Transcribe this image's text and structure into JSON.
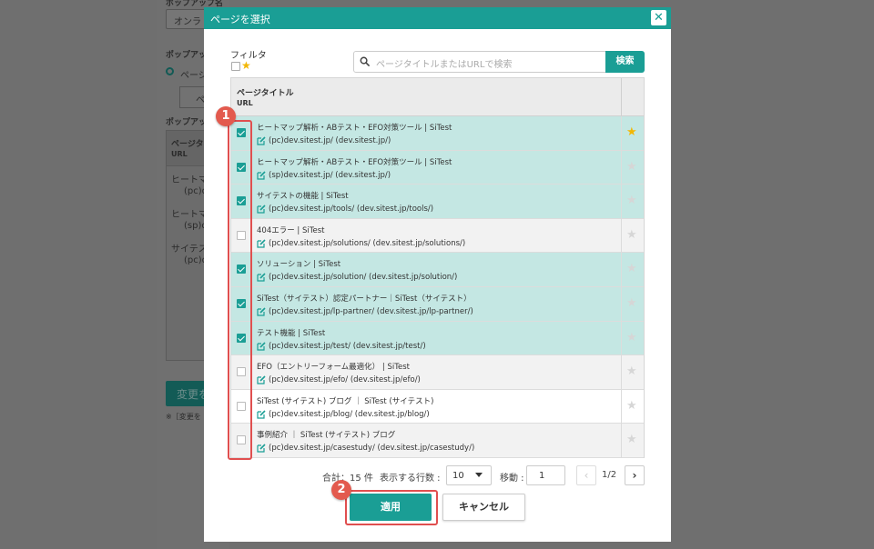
{
  "background": {
    "popup_name_label": "ポップアップ名",
    "select_value": "オンラ",
    "section_label_1": "ポップアッ",
    "radio_label": "ページ",
    "box_label": "ペ",
    "section_label_2": "ポップアッ",
    "table_head_title": "ページタ",
    "table_head_url": "URL",
    "rows": [
      {
        "title": "ヒートマ",
        "url": "(pc)de"
      },
      {
        "title": "ヒートマ",
        "url": "(sp)de"
      },
      {
        "title": "サイテス",
        "url": "(pc)de"
      }
    ],
    "save_button": "変更を",
    "note": "※［変更を"
  },
  "modal": {
    "title": "ページを選択",
    "close_icon": "close-icon",
    "filter_label": "フィルタ",
    "search_placeholder": "ページタイトルまたはURLで検索",
    "search_button": "検索",
    "table": {
      "col_title": "ページタイトル",
      "col_url": "URL",
      "rows": [
        {
          "title": "ヒートマップ解析・ABテスト・EFO対策ツール | SiTest",
          "url": "(pc)dev.sitest.jp/ (dev.sitest.jp/)",
          "checked": true,
          "starred": true,
          "tone": "sel"
        },
        {
          "title": "ヒートマップ解析・ABテスト・EFO対策ツール | SiTest",
          "url": "(sp)dev.sitest.jp/ (dev.sitest.jp/)",
          "checked": true,
          "starred": false,
          "tone": "sel"
        },
        {
          "title": "サイテストの機能 | SiTest",
          "url": "(pc)dev.sitest.jp/tools/ (dev.sitest.jp/tools/)",
          "checked": true,
          "starred": false,
          "tone": "sel"
        },
        {
          "title": "404エラー | SiTest",
          "url": "(pc)dev.sitest.jp/solutions/ (dev.sitest.jp/solutions/)",
          "checked": false,
          "starred": false,
          "tone": "alt"
        },
        {
          "title": "ソリューション | SiTest",
          "url": "(pc)dev.sitest.jp/solution/ (dev.sitest.jp/solution/)",
          "checked": true,
          "starred": false,
          "tone": "sel"
        },
        {
          "title": "SiTest（サイテスト）認定パートナー｜SiTest（サイテスト）",
          "url": "(pc)dev.sitest.jp/lp-partner/ (dev.sitest.jp/lp-partner/)",
          "checked": true,
          "starred": false,
          "tone": "sel"
        },
        {
          "title": "テスト機能 | SiTest",
          "url": "(pc)dev.sitest.jp/test/ (dev.sitest.jp/test/)",
          "checked": true,
          "starred": false,
          "tone": "sel"
        },
        {
          "title": "EFO（エントリーフォーム最適化） | SiTest",
          "url": "(pc)dev.sitest.jp/efo/ (dev.sitest.jp/efo/)",
          "checked": false,
          "starred": false,
          "tone": "alt"
        },
        {
          "title": "SiTest (サイテスト) ブログ ｜ SiTest (サイテスト)",
          "url": "(pc)dev.sitest.jp/blog/ (dev.sitest.jp/blog/)",
          "checked": false,
          "starred": false,
          "tone": "plain"
        },
        {
          "title": "事例紹介 ｜ SiTest (サイテスト) ブログ",
          "url": "(pc)dev.sitest.jp/casestudy/ (dev.sitest.jp/casestudy/)",
          "checked": false,
          "starred": false,
          "tone": "alt"
        }
      ]
    },
    "pager": {
      "total": "合計：15 件",
      "rows_label": "表示する行数 :",
      "rows_value": "10",
      "move_label": "移動 :",
      "move_value": "1",
      "page_indicator": "1/2",
      "prev_icon": "chevron-left-icon",
      "next_icon": "chevron-right-icon"
    },
    "apply_button": "適用",
    "cancel_button": "キャンセル"
  },
  "annotations": {
    "badge_1": "1",
    "badge_2": "2"
  },
  "colors": {
    "accent": "#1a9e95",
    "selected_row": "#c4e7e3",
    "star_active": "#f2b705",
    "annotation": "#e04f4f"
  }
}
